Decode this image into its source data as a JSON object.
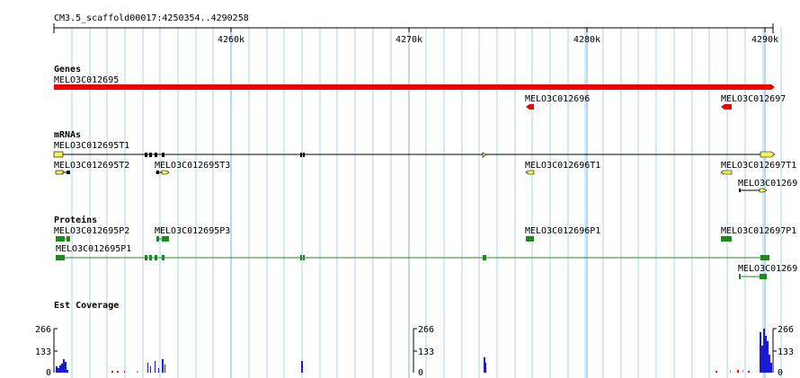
{
  "location": "CM3.5_scaffold00017:4250354..4290258",
  "ruler": {
    "ticks": [
      "4260k",
      "4270k",
      "4280k",
      "4290k"
    ]
  },
  "tracks": {
    "genes": {
      "title": "Genes",
      "features": [
        {
          "name": "MELO3C012695",
          "start": 4250354,
          "end": 4290258,
          "strand": "+"
        },
        {
          "name": "MELO3C012696",
          "start": 4276700,
          "end": 4277100,
          "strand": "-"
        },
        {
          "name": "MELO3C012697",
          "start": 4287700,
          "end": 4288300,
          "strand": "-"
        }
      ]
    },
    "mrnas": {
      "title": "mRNAs",
      "features": [
        {
          "name": "MELO3C012695T1",
          "start": 4250354,
          "end": 4290258
        },
        {
          "name": "MELO3C012695T2",
          "start": 4250354,
          "end": 4251200
        },
        {
          "name": "MELO3C012695T3",
          "start": 4256000,
          "end": 4256800
        },
        {
          "name": "MELO3C012696T1",
          "start": 4276700,
          "end": 4277100
        },
        {
          "name": "MELO3C012697T1",
          "start": 4287700,
          "end": 4288400
        },
        {
          "name": "MELO3C01269",
          "start": 4288400,
          "end": 4290000
        }
      ]
    },
    "proteins": {
      "title": "Proteins",
      "features": [
        {
          "name": "MELO3C012695P2",
          "start": 4250354,
          "end": 4251200
        },
        {
          "name": "MELO3C012695P3",
          "start": 4256000,
          "end": 4256800
        },
        {
          "name": "MELO3C012696P1",
          "start": 4276700,
          "end": 4277100
        },
        {
          "name": "MELO3C012697P1",
          "start": 4287700,
          "end": 4288400
        },
        {
          "name": "MELO3C012695P1",
          "start": 4250354,
          "end": 4290258
        },
        {
          "name": "MELO3C01269",
          "start": 4288400,
          "end": 4290000
        }
      ]
    },
    "est": {
      "title": "Est Coverage",
      "scale": [
        "266",
        "133",
        "0"
      ]
    }
  },
  "colors": {
    "gene": "#ee0000",
    "mrna_exon": "#f3f35a",
    "protein": "#1e8a1e",
    "coverage": "#1a1ad2",
    "grid": "#a9d4ee"
  }
}
